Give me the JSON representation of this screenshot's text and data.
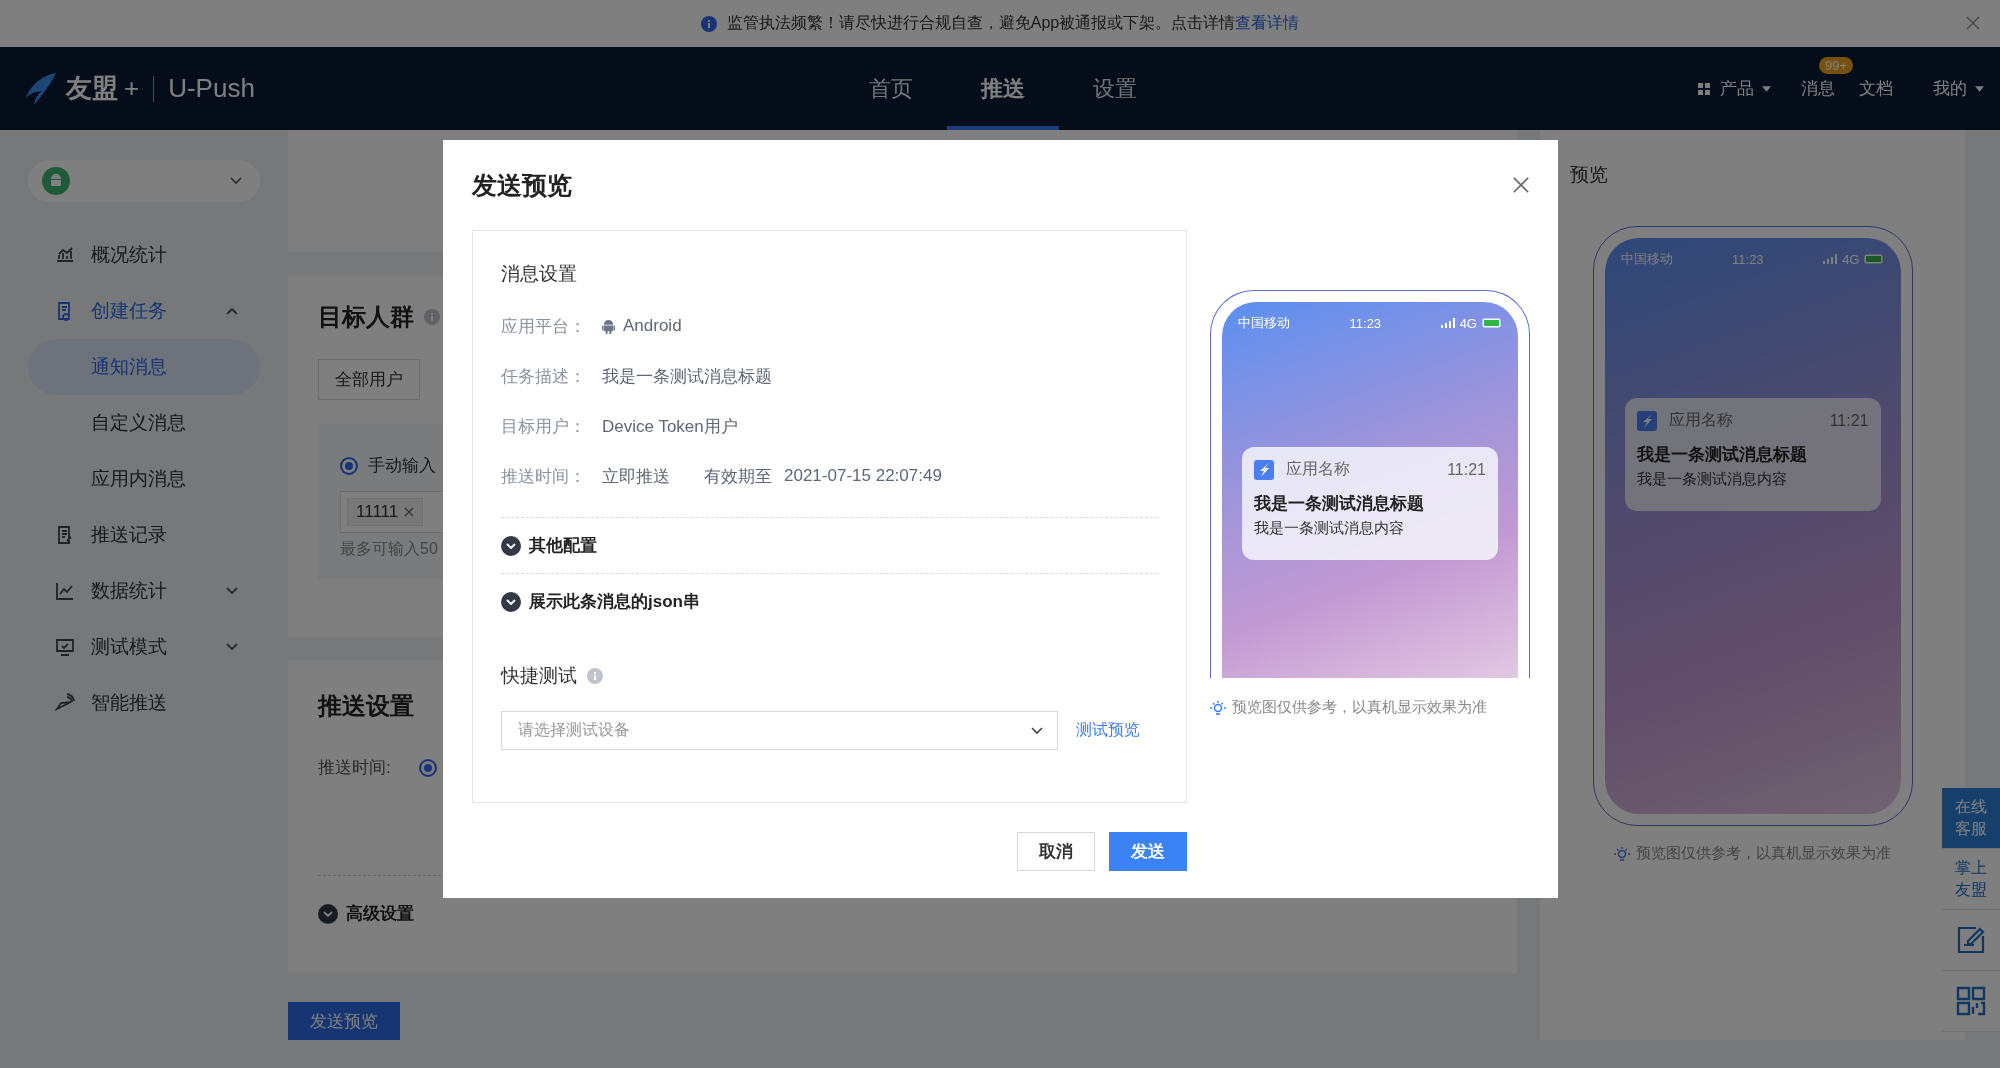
{
  "notice": {
    "text": "监管执法频繁！请尽快进行合规自查，避免App被通报或下架。点击详情",
    "link": "查看详情"
  },
  "brand": {
    "name": "友盟",
    "plus": "+",
    "product": "U-Push"
  },
  "nav": [
    {
      "label": "首页",
      "selected": false
    },
    {
      "label": "推送",
      "selected": true
    },
    {
      "label": "设置",
      "selected": false
    }
  ],
  "header_right": {
    "products": "产品",
    "messages": "消息",
    "badge": "99+",
    "docs": "文档",
    "mine": "我的"
  },
  "sidebar": {
    "items": [
      {
        "label": "概况统计",
        "selected": false
      },
      {
        "label": "创建任务",
        "selected": true,
        "expanded": true,
        "children": [
          {
            "label": "通知消息",
            "selected": true
          },
          {
            "label": "自定义消息",
            "selected": false
          },
          {
            "label": "应用内消息",
            "selected": false
          }
        ]
      },
      {
        "label": "推送记录",
        "selected": false
      },
      {
        "label": "数据统计",
        "selected": false,
        "expanded": false
      },
      {
        "label": "测试模式",
        "selected": false,
        "expanded": false
      },
      {
        "label": "智能推送",
        "selected": false
      }
    ]
  },
  "target_group": {
    "title": "目标人群",
    "tabs": [
      {
        "label": "全部用户",
        "selected": false
      }
    ],
    "radio": {
      "label": "手动输入",
      "selected": true
    },
    "tags": [
      "11111"
    ],
    "hint": "最多可输入50"
  },
  "push_settings": {
    "title": "推送设置",
    "time_label": "推送时间:",
    "time_selected": true,
    "advanced": {
      "label": "高级设置",
      "expanded": false
    }
  },
  "preview_button": "发送预览",
  "preview_panel": {
    "title": "预览",
    "phone": {
      "carrier": "中国移动",
      "time": "11:23",
      "network": "4G",
      "notification": {
        "app": "应用名称",
        "time": "11:21",
        "title": "我是一条测试消息标题",
        "body": "我是一条测试消息内容"
      }
    },
    "hint": "预览图仅供参考，以真机显示效果为准"
  },
  "float_tools": [
    {
      "label": "在线客服",
      "kind": "primary"
    },
    {
      "label": "掌上友盟",
      "kind": "plain"
    }
  ],
  "modal": {
    "title": "发送预览",
    "section": "消息设置",
    "fields": [
      {
        "label": "应用平台：",
        "value": "Android",
        "kind": "platform"
      },
      {
        "label": "任务描述：",
        "value": "我是一条测试消息标题",
        "kind": "text"
      },
      {
        "label": "目标用户：",
        "value": "Device Token用户",
        "kind": "text"
      },
      {
        "label": "推送时间：",
        "value": "立即推送",
        "kind": "time",
        "extra_label": "有效期至",
        "extra_value": "2021-07-15 22:07:49"
      }
    ],
    "collapsibles": [
      {
        "label": "其他配置",
        "expanded": false
      },
      {
        "label": "展示此条消息的json串",
        "expanded": false
      }
    ],
    "quick_test": {
      "title": "快捷测试",
      "select": {
        "placeholder": "请选择测试设备"
      },
      "link": "测试预览"
    },
    "phone": {
      "carrier": "中国移动",
      "time": "11:23",
      "network": "4G",
      "notification": {
        "app": "应用名称",
        "time": "11:21",
        "title": "我是一条测试消息标题",
        "body": "我是一条测试消息内容"
      }
    },
    "hint": "预览图仅供参考，以真机显示效果为准",
    "buttons": [
      {
        "label": "取消",
        "kind": "secondary"
      },
      {
        "label": "发送",
        "kind": "primary"
      }
    ]
  }
}
